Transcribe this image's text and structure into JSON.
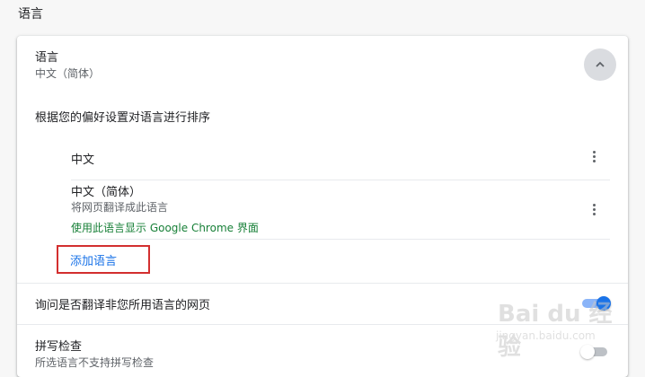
{
  "section": {
    "title": "语言"
  },
  "language": {
    "label": "语言",
    "value": "中文（简体）",
    "order_description": "根据您的偏好设置对语言进行排序",
    "list": [
      {
        "name": "中文"
      },
      {
        "name": "中文（简体）",
        "subtitle": "将网页翻译成此语言",
        "ui_note": "使用此语言显示 Google Chrome 界面"
      }
    ],
    "add_label": "添加语言"
  },
  "translate": {
    "label": "询问是否翻译非您所用语言的网页",
    "enabled": true
  },
  "spellcheck": {
    "label": "拼写检查",
    "subtitle": "所选语言不支持拼写检查",
    "enabled": false
  },
  "watermark": {
    "text": "Bai du 经验",
    "sub": "jingyan.baidu.com"
  },
  "colors": {
    "accent": "#1a73e8",
    "green": "#188038",
    "highlight_box": "#d32f2f"
  },
  "icons": {
    "collapse": "chevron-up-icon",
    "more": "more-vert-icon"
  }
}
